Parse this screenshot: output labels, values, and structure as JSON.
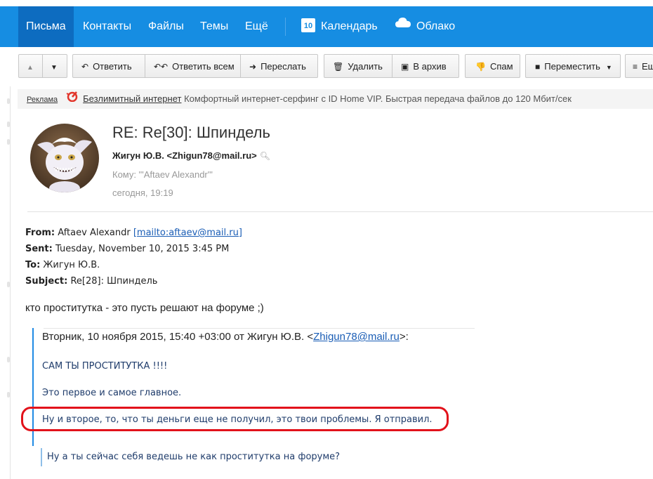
{
  "navbar": {
    "items": [
      {
        "label": "Письма"
      },
      {
        "label": "Контакты"
      },
      {
        "label": "Файлы"
      },
      {
        "label": "Темы"
      },
      {
        "label": "Ещё"
      }
    ],
    "calendar": {
      "label": "Календарь",
      "day": "10"
    },
    "cloud": {
      "label": "Облако"
    }
  },
  "toolbar": {
    "reply": "Ответить",
    "reply_all": "Ответить всем",
    "forward": "Переслать",
    "delete": "Удалить",
    "archive": "В архив",
    "spam": "Спам",
    "move": "Переместить",
    "more": "Ещ"
  },
  "ad": {
    "label": "Реклама",
    "link": "Безлимитный интернет",
    "text": "Комфортный интернет-серфинг с ID Home VIP. Быстрая передача файлов до 120 Мбит/сек"
  },
  "message": {
    "subject": "RE: Re[30]: Шпиндель",
    "from": "Жигун Ю.В. <Zhigun78@mail.ru>",
    "to": "Кому: \"'Aftaev Alexandr'\"",
    "date": "сегодня, 19:19"
  },
  "headers": {
    "from_label": "From:",
    "from_value": "Aftaev Alexandr",
    "from_link": "[mailto:aftaev@mail.ru]",
    "sent_label": "Sent:",
    "sent_value": "Tuesday, November 10, 2015 3:45 PM",
    "to_label": "To:",
    "to_value": "Жигун Ю.В.",
    "subject_label": "Subject:",
    "subject_value": "Re[28]: Шпиндель"
  },
  "body_text": "кто проститутка - это пусть решают на форуме ;)",
  "quote": {
    "head_prefix": "Вторник, 10 ноября 2015, 15:40 +03:00 от Жигун Ю.В. <",
    "head_email": "Zhigun78@mail.ru",
    "head_suffix": ">:",
    "line1": "САМ ТЫ ПРОСТИТУТКА !!!!",
    "line2": "Это первое и самое главное.",
    "line3": "Ну и второе, то, что ты деньги еще не получил, это твои проблемы. Я отправил.",
    "line4": "Ну а ты сейчас себя ведешь не как проститутка на форуме?"
  },
  "colors": {
    "navbar": "#168de2",
    "highlight": "#e2121b",
    "quote_border": "#1f8ae4"
  }
}
